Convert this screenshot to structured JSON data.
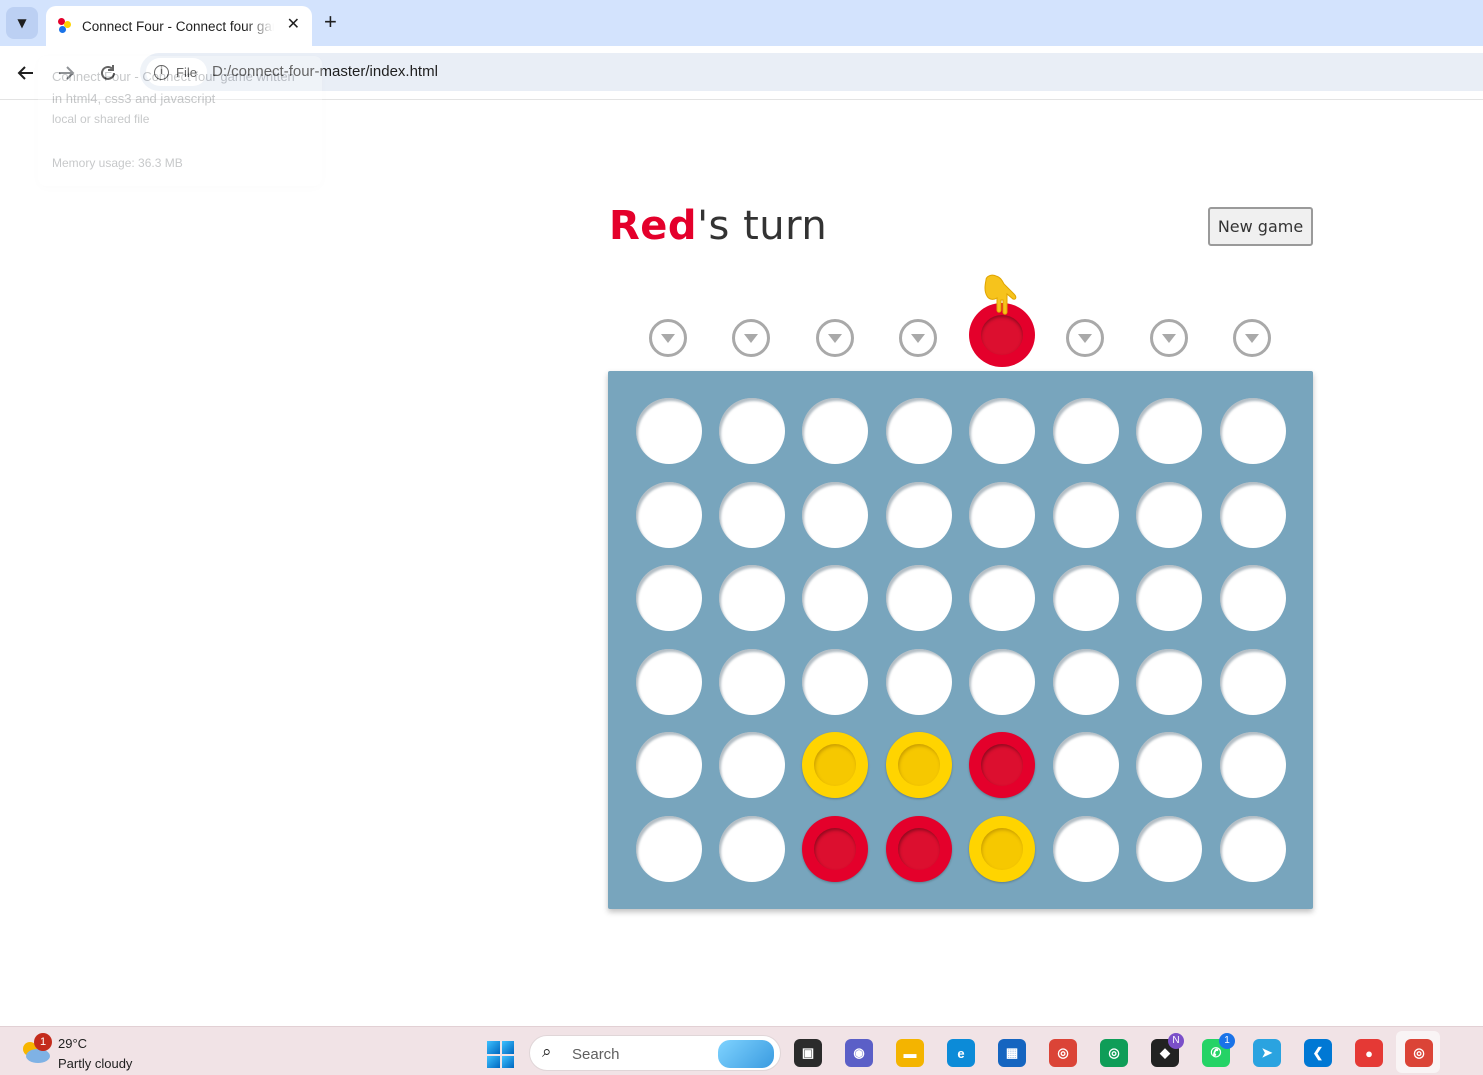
{
  "browser": {
    "tab_title": "Connect Four - Connect four game written in html4, css3 and javascript",
    "new_tab_symbol": "+",
    "close_symbol": "✕",
    "chip_label": "File",
    "url": "D:/connect-four-master/index.html",
    "hover_card": {
      "title": "Connect Four - Connect four game written in html4, css3 and javascript",
      "subtitle": "local or shared file",
      "memory": "Memory usage: 36.3 MB"
    }
  },
  "game": {
    "status_player": "Red",
    "status_suffix": "'s turn",
    "new_game_label": "New game",
    "current_player": "red",
    "hover_column": 4,
    "columns": 8,
    "rows": 6,
    "board": [
      [
        "",
        "",
        "",
        "",
        "",
        "",
        "",
        ""
      ],
      [
        "",
        "",
        "",
        "",
        "",
        "",
        "",
        ""
      ],
      [
        "",
        "",
        "",
        "",
        "",
        "",
        "",
        ""
      ],
      [
        "",
        "",
        "",
        "",
        "",
        "",
        "",
        ""
      ],
      [
        "",
        "",
        "yellow",
        "yellow",
        "red",
        "",
        "",
        ""
      ],
      [
        "",
        "",
        "red",
        "red",
        "yellow",
        "",
        "",
        ""
      ]
    ],
    "colors": {
      "red": "#e4002b",
      "yellow": "#ffd400",
      "board": "#78a5bd"
    }
  },
  "taskbar": {
    "weather_temp": "29°C",
    "weather_desc": "Partly cloudy",
    "weather_badge": "1",
    "search_placeholder": "Search",
    "apps": [
      {
        "name": "task-view",
        "glyph": "▣",
        "color": "#2b2b2b"
      },
      {
        "name": "meet",
        "glyph": "◉",
        "color": "#5b5fc7"
      },
      {
        "name": "file-explorer",
        "glyph": "▬",
        "color": "#f4b400"
      },
      {
        "name": "edge",
        "glyph": "e",
        "color": "#0c8bd8"
      },
      {
        "name": "microsoft-store",
        "glyph": "▦",
        "color": "#1565c0"
      },
      {
        "name": "chrome",
        "glyph": "◎",
        "color": "#db4437"
      },
      {
        "name": "chrome-profile",
        "glyph": "◎",
        "color": "#0f9d58"
      },
      {
        "name": "github",
        "glyph": "◆",
        "color": "#222222"
      },
      {
        "name": "whatsapp",
        "glyph": "✆",
        "color": "#25d366"
      },
      {
        "name": "telegram",
        "glyph": "➤",
        "color": "#2aa3e0"
      },
      {
        "name": "vscode",
        "glyph": "❮",
        "color": "#0078d4"
      },
      {
        "name": "recorder",
        "glyph": "●",
        "color": "#e53935"
      },
      {
        "name": "chrome-active",
        "glyph": "◎",
        "color": "#db4437"
      }
    ],
    "badges": {
      "github": "N",
      "whatsapp": "1"
    }
  }
}
